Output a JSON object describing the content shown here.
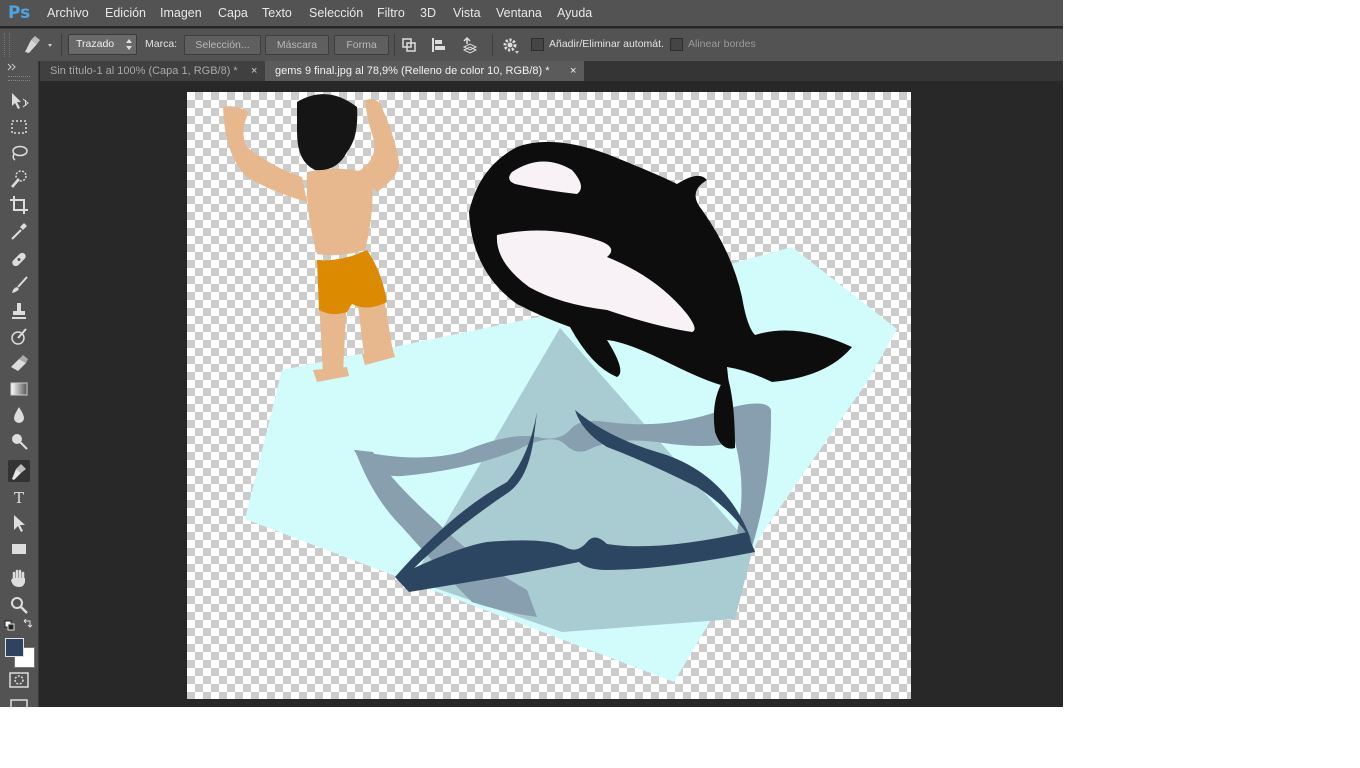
{
  "app": {
    "logo": "Ps"
  },
  "menu": {
    "items": [
      "Archivo",
      "Edición",
      "Imagen",
      "Capa",
      "Texto",
      "Selección",
      "Filtro",
      "3D",
      "Vista",
      "Ventana",
      "Ayuda"
    ]
  },
  "options": {
    "mode": "Trazado",
    "make_label": "Marca:",
    "selection_button": "Selección...",
    "mask_button": "Máscara",
    "shape_button": "Forma",
    "auto_add_delete": "Añadir/Eliminar automát.",
    "align_edges": "Alinear bordes"
  },
  "tabs": [
    {
      "title": "Sin título-1 al 100% (Capa 1, RGB/8) *",
      "close": "×",
      "active": false
    },
    {
      "title": "gems 9 final.jpg al 78,9% (Relleno de color 10, RGB/8) *",
      "close": "×",
      "active": true
    }
  ],
  "tools": [
    "move-tool",
    "marquee-tool",
    "lasso-tool",
    "quick-selection-tool",
    "crop-tool",
    "eyedropper-tool",
    "healing-brush-tool",
    "brush-tool",
    "clone-stamp-tool",
    "history-brush-tool",
    "eraser-tool",
    "gradient-tool",
    "blur-tool",
    "dodge-tool",
    "pen-tool",
    "type-tool",
    "path-selection-tool",
    "rectangle-tool",
    "hand-tool",
    "zoom-tool"
  ],
  "colors": {
    "foreground": "#2e4360",
    "background": "#ffffff",
    "accent": "#4ea3e0"
  }
}
